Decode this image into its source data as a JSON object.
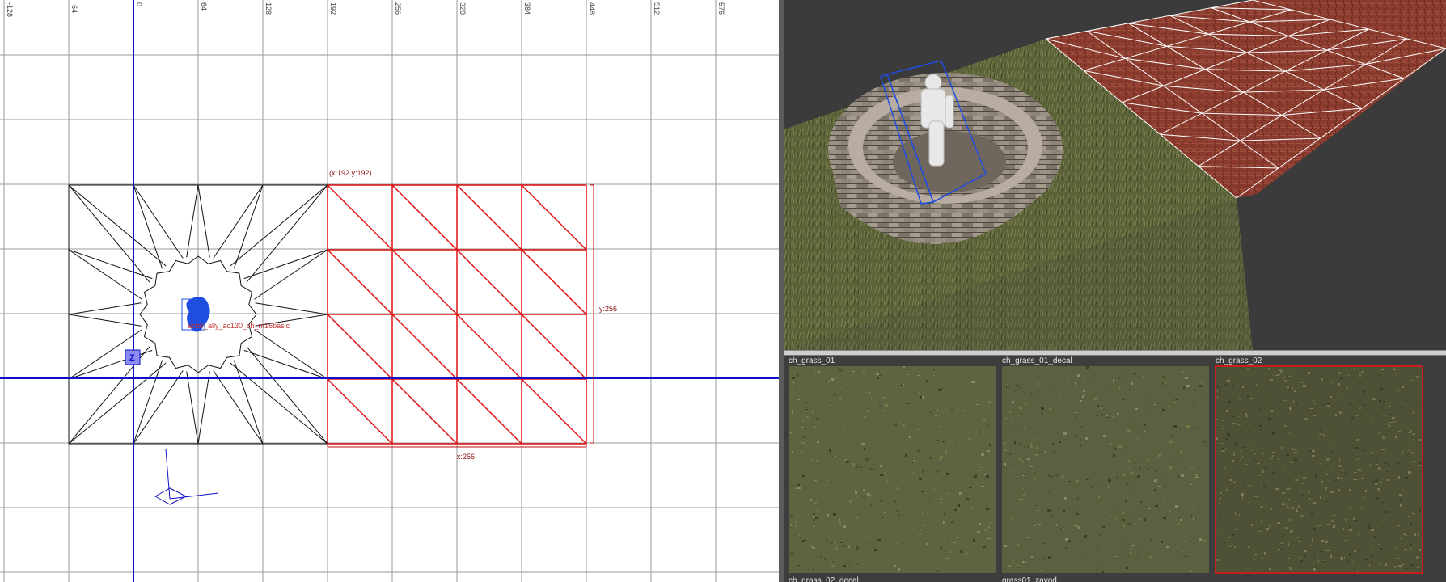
{
  "grid_view": {
    "ruler_labels": [
      "-128",
      "-64",
      "0",
      "64",
      "128",
      "192",
      "256",
      "320",
      "384",
      "448",
      "512",
      "576"
    ],
    "brush_origin_label": "(x:192  y:192)",
    "width_label": "x:256",
    "height_label": "y:256",
    "entity_label": "actor_ally_ac130_ch_m16basic",
    "z_marker": "Z",
    "colors": {
      "grid": "#9a9a9a",
      "axis": "#1010c8",
      "selection": "#e01010",
      "brush": "#111111",
      "entity": "#1f4de0"
    }
  },
  "texture_browser": {
    "selected": "ch_grass_02",
    "textures": [
      {
        "name": "ch_grass_01"
      },
      {
        "name": "ch_grass_01_decal"
      },
      {
        "name": "ch_grass_02"
      },
      {
        "name": "ch_grass_02_decal"
      },
      {
        "name": "grass01_zavod"
      }
    ]
  }
}
